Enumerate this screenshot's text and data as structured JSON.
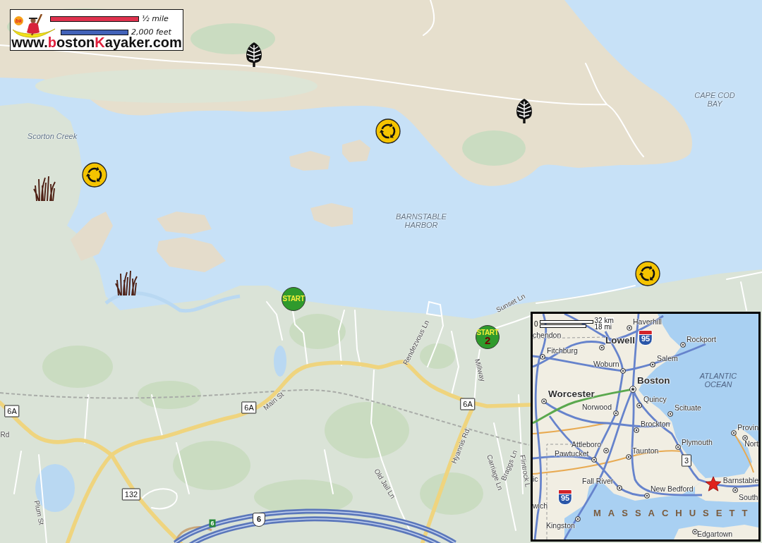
{
  "logo": {
    "badge": "bk",
    "url_parts": [
      {
        "text": "www.",
        "accent": false
      },
      {
        "text": "b",
        "accent": true
      },
      {
        "text": "oston",
        "accent": false
      },
      {
        "text": "K",
        "accent": true
      },
      {
        "text": "ayaker.com",
        "accent": false
      }
    ]
  },
  "scale_bars": [
    {
      "label": "½ mile",
      "color": "#e0324e"
    },
    {
      "label": "2,000 feet",
      "color": "#4262b8"
    }
  ],
  "map": {
    "water_labels": [
      "Scorton Creek",
      "CAPE COD BAY",
      "BARNSTABLE HARBOR"
    ],
    "street_labels": [
      "Main St",
      "Rendezvous Ln",
      "Sunset Ln",
      "Millway",
      "Hyannis Rd",
      "Old Jail Ln",
      "Carriage Ln",
      "Braggs Ln",
      "Flintrock L",
      "Plum St",
      "Rd"
    ],
    "route_shields": [
      {
        "kind": "state",
        "label": "6A"
      },
      {
        "kind": "state",
        "label": "6A"
      },
      {
        "kind": "state",
        "label": "6A"
      },
      {
        "kind": "state",
        "label": "132"
      },
      {
        "kind": "us",
        "label": "6"
      },
      {
        "kind": "exit",
        "label": "6"
      }
    ],
    "markers": [
      {
        "label": "START"
      },
      {
        "label": "START",
        "number": "2"
      }
    ]
  },
  "inset_map": {
    "scale": {
      "zero": "0",
      "units": [
        "32 km",
        "18 mi"
      ]
    },
    "places": [
      {
        "name": "Haverhill",
        "kind": "town"
      },
      {
        "name": "chendon",
        "kind": "town"
      },
      {
        "name": "Lowell",
        "kind": "major"
      },
      {
        "name": "Rockport",
        "kind": "town"
      },
      {
        "name": "Fitchburg",
        "kind": "town"
      },
      {
        "name": "Salem",
        "kind": "town"
      },
      {
        "name": "Woburn",
        "kind": "town"
      },
      {
        "name": "Boston",
        "kind": "major"
      },
      {
        "name": "Worcester",
        "kind": "major"
      },
      {
        "name": "Quincy",
        "kind": "town"
      },
      {
        "name": "Norwood",
        "kind": "town"
      },
      {
        "name": "Scituate",
        "kind": "town"
      },
      {
        "name": "Brockton",
        "kind": "town"
      },
      {
        "name": "Provin",
        "kind": "town"
      },
      {
        "name": "Attleboro",
        "kind": "town"
      },
      {
        "name": "Plymouth",
        "kind": "town"
      },
      {
        "name": "Nort",
        "kind": "town"
      },
      {
        "name": "Pawtucket",
        "kind": "town"
      },
      {
        "name": "Taunton",
        "kind": "town"
      },
      {
        "name": "ic",
        "kind": "town"
      },
      {
        "name": "Fall River",
        "kind": "town"
      },
      {
        "name": "Barnstable",
        "kind": "town"
      },
      {
        "name": "New Bedford",
        "kind": "town"
      },
      {
        "name": "South",
        "kind": "town"
      },
      {
        "name": "wich",
        "kind": "town"
      },
      {
        "name": "Kingston",
        "kind": "town"
      },
      {
        "name": "Edgartown",
        "kind": "town"
      }
    ],
    "ocean_label": "ATLANTIC OCEAN",
    "state_label": "MASSACHUSETT",
    "shields": [
      {
        "kind": "interstate",
        "label": "95"
      },
      {
        "kind": "interstate",
        "label": "95"
      },
      {
        "kind": "state",
        "label": "3"
      }
    ]
  }
}
